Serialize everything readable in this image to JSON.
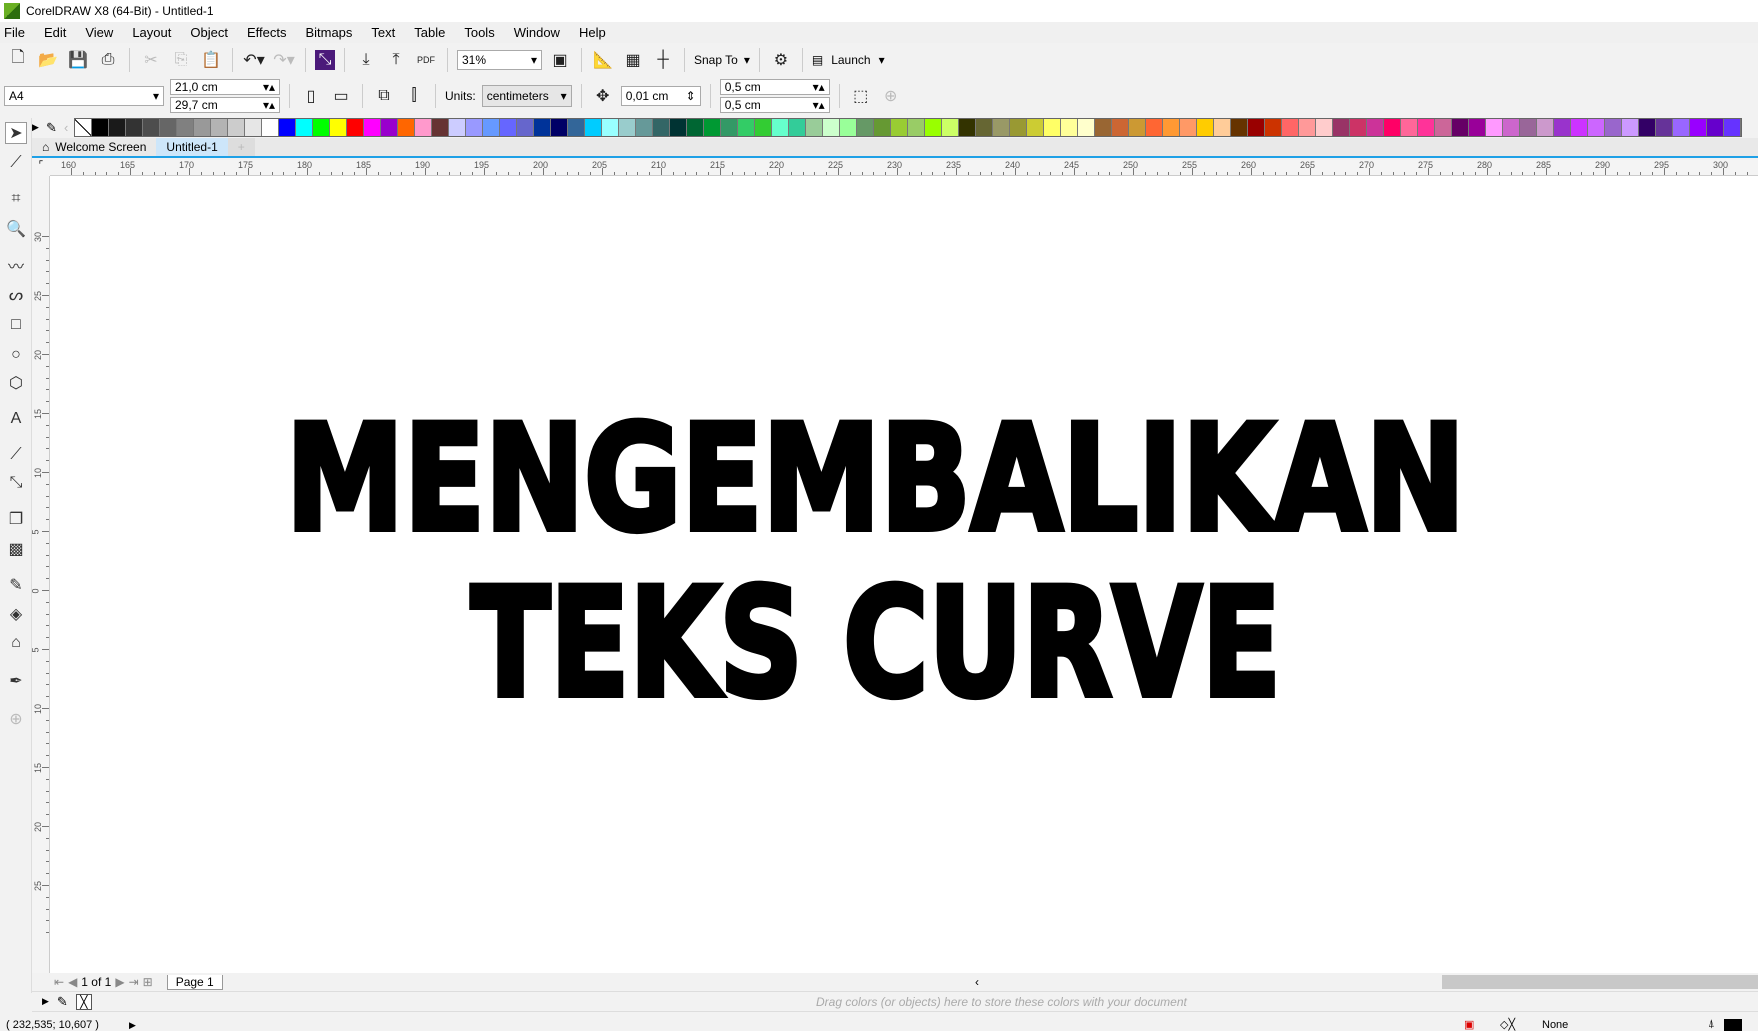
{
  "window": {
    "title": "CorelDRAW X8 (64-Bit) - Untitled-1"
  },
  "menu": [
    "File",
    "Edit",
    "View",
    "Layout",
    "Object",
    "Effects",
    "Bitmaps",
    "Text",
    "Table",
    "Tools",
    "Window",
    "Help"
  ],
  "toolbar": {
    "zoom": "31%",
    "snap_to": "Snap To",
    "launch": "Launch",
    "pdf": "PDF"
  },
  "property_bar": {
    "page_size": "A4",
    "width": "21,0 cm",
    "height": "29,7 cm",
    "units_label": "Units:",
    "units": "centimeters",
    "nudge": "0,01 cm",
    "dup_x": "0,5 cm",
    "dup_y": "0,5 cm"
  },
  "palette_colors": [
    "#000000",
    "#1a1a1a",
    "#333333",
    "#4d4d4d",
    "#666666",
    "#808080",
    "#999999",
    "#b3b3b3",
    "#cccccc",
    "#e6e6e6",
    "#ffffff",
    "#0000ff",
    "#00ffff",
    "#00ff00",
    "#ffff00",
    "#ff0000",
    "#ff00ff",
    "#9900cc",
    "#ff6600",
    "#ff99cc",
    "#663333",
    "#ccccff",
    "#9999ff",
    "#6699ff",
    "#6666ff",
    "#6666cc",
    "#003399",
    "#000066",
    "#336699",
    "#00ccff",
    "#99ffff",
    "#99cccc",
    "#669999",
    "#336666",
    "#003333",
    "#006633",
    "#009933",
    "#339966",
    "#33cc66",
    "#33cc33",
    "#66ffcc",
    "#33cc99",
    "#99cc99",
    "#ccffcc",
    "#99ff99",
    "#669966",
    "#669933",
    "#99cc33",
    "#99cc66",
    "#99ff00",
    "#ccff66",
    "#333300",
    "#666633",
    "#999966",
    "#999933",
    "#cccc33",
    "#ffff66",
    "#ffff99",
    "#ffffcc",
    "#996633",
    "#cc6633",
    "#cc9933",
    "#ff6633",
    "#ff9933",
    "#ff9966",
    "#ffcc00",
    "#ffcc99",
    "#663300",
    "#990000",
    "#cc3300",
    "#ff6666",
    "#ff9999",
    "#ffcccc",
    "#993366",
    "#cc3366",
    "#cc3399",
    "#ff0066",
    "#ff6699",
    "#ff3399",
    "#cc6699",
    "#660066",
    "#990099",
    "#ff99ff",
    "#cc66cc",
    "#996699",
    "#cc99cc",
    "#9933cc",
    "#cc33ff",
    "#cc66ff",
    "#9966cc",
    "#cc99ff",
    "#330066",
    "#663399",
    "#9966ff",
    "#9900ff",
    "#6600cc",
    "#6633ff"
  ],
  "tabs": {
    "welcome": "Welcome Screen",
    "doc": "Untitled-1"
  },
  "rulers": {
    "h": [
      "160",
      "165",
      "170",
      "175",
      "180",
      "185",
      "190",
      "195",
      "200",
      "205",
      "210",
      "215",
      "220",
      "225",
      "230",
      "235",
      "240",
      "245",
      "250",
      "255",
      "260",
      "265",
      "270",
      "275",
      "280",
      "285",
      "290",
      "295",
      "300"
    ],
    "v": [
      "30",
      "25",
      "20",
      "15",
      "10",
      "5",
      "0",
      "5",
      "10",
      "15",
      "20",
      "25"
    ]
  },
  "canvas": {
    "line1": "MENGEMBALIKAN",
    "line2": "TEKS CURVE"
  },
  "page_nav": {
    "count": "1 of 1",
    "page_tab": "Page 1"
  },
  "doc_palette": {
    "hint": "Drag colors (or objects) here to store these colors with your document"
  },
  "status": {
    "coords": "( 232,535; 10,607 )",
    "fill": "None"
  }
}
